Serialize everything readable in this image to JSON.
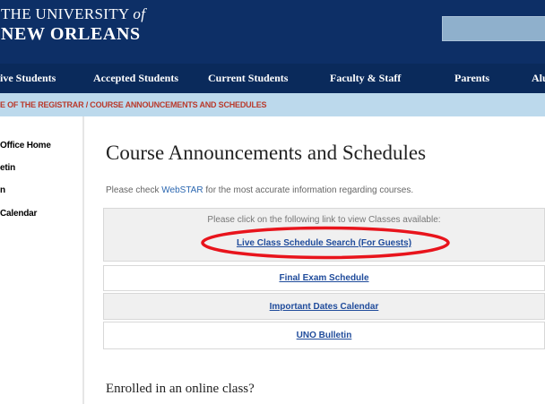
{
  "header": {
    "logo_line1": "THE UNIVERSITY ",
    "logo_line1_of": "of",
    "logo_line2": "NEW ORLEANS",
    "search_placeholder": ""
  },
  "nav": {
    "items": [
      "ive Students",
      "Accepted Students",
      "Current Students",
      "Faculty & Staff",
      "Parents",
      "Alu"
    ]
  },
  "breadcrumb": {
    "text": "E OF THE REGISTRAR / COURSE ANNOUNCEMENTS AND SCHEDULES"
  },
  "sidebar": {
    "items": [
      "Office Home",
      "etin",
      "n",
      "Calendar"
    ]
  },
  "main": {
    "title": "Course Announcements and Schedules",
    "intro_before": "Please check ",
    "intro_link": "WebSTAR",
    "intro_after": " for the most accurate information regarding courses.",
    "box_note": "Please click on the following link to view Classes available:",
    "links": [
      "Live Class Schedule Search (For Guests)",
      "Final Exam Schedule",
      "Important Dates Calendar",
      "UNO Bulletin"
    ],
    "subheading": "Enrolled in an online class?"
  },
  "colors": {
    "header_bg": "#0d2f66",
    "nav_bg": "#0a2a5b",
    "breadcrumb_bg": "#bcd9ec",
    "breadcrumb_text": "#b93a2c",
    "link": "#1f4b9b",
    "annotation": "#e8141c"
  }
}
